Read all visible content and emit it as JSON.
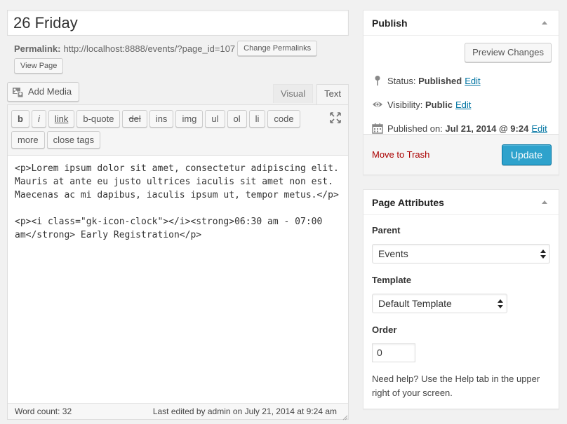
{
  "editor": {
    "title": "26 Friday",
    "permalink_label": "Permalink:",
    "permalink_url": "http://localhost:8888/events/?page_id=107",
    "change_permalinks": "Change Permalinks",
    "view_page": "View Page",
    "add_media": "Add Media",
    "tabs": [
      "Visual",
      "Text"
    ],
    "active_tab": "Text",
    "quicktags": [
      "b",
      "i",
      "link",
      "b-quote",
      "del",
      "ins",
      "img",
      "ul",
      "ol",
      "li",
      "code",
      "more",
      "close tags"
    ],
    "content": "<p>Lorem ipsum dolor sit amet, consectetur adipiscing elit. Mauris at ante eu justo ultrices iaculis sit amet non est. Maecenas ac mi dapibus, iaculis ipsum ut, tempor metus.</p>\n\n<p><i class=\"gk-icon-clock\"></i><strong>06:30 am - 07:00 am</strong> Early Registration</p>",
    "word_count": "Word count: 32",
    "last_edited": "Last edited by admin on July 21, 2014 at 9:24 am"
  },
  "publish": {
    "title": "Publish",
    "preview": "Preview Changes",
    "status_label": "Status:",
    "status_value": "Published",
    "visibility_label": "Visibility:",
    "visibility_value": "Public",
    "published_label": "Published on:",
    "published_value": "Jul 21, 2014 @ 9:24",
    "edit": "Edit",
    "trash": "Move to Trash",
    "update": "Update"
  },
  "attributes": {
    "title": "Page Attributes",
    "parent_label": "Parent",
    "parent_value": "Events",
    "template_label": "Template",
    "template_value": "Default Template",
    "order_label": "Order",
    "order_value": "0",
    "help": "Need help? Use the Help tab in the upper right of your screen."
  },
  "colors": {
    "link": "#0074a2",
    "primary": "#2ea2cc",
    "trash": "#aa0000"
  }
}
